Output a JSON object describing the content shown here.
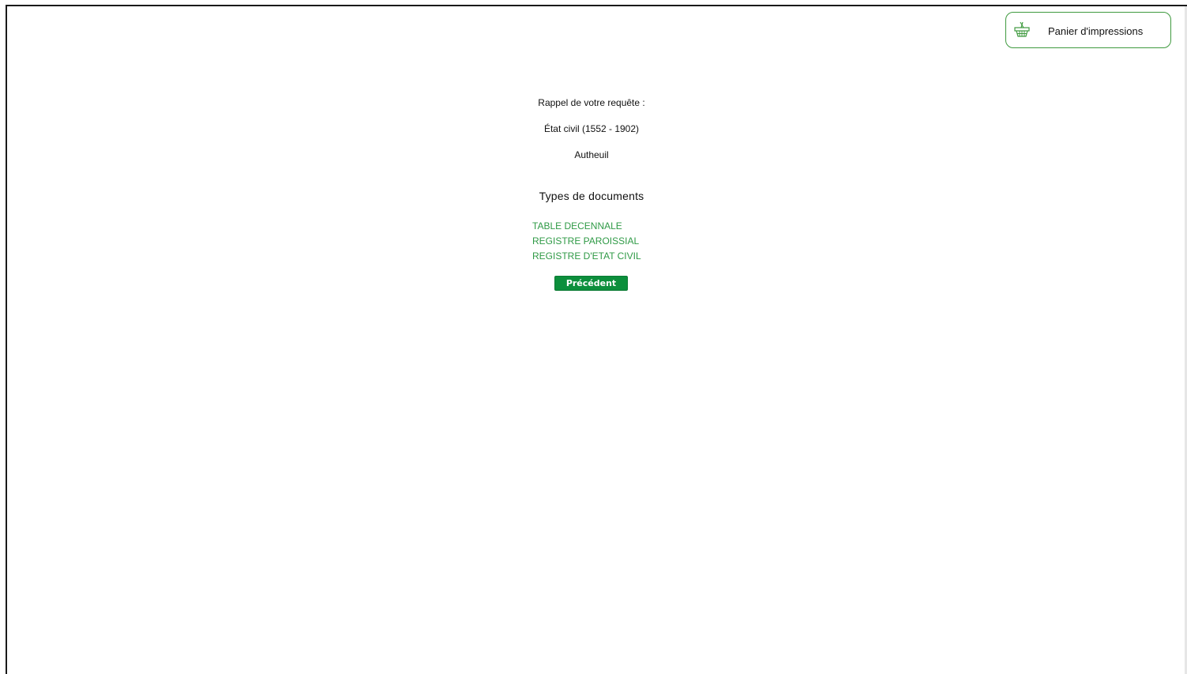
{
  "header": {
    "cart_label": "Panier d'impressions",
    "cart_icon": "basket-icon"
  },
  "query": {
    "recall_label": "Rappel de votre requête :",
    "fonds": "État civil (1552 - 1902)",
    "place": "Autheuil"
  },
  "documents": {
    "heading": "Types de documents",
    "items": [
      {
        "label": "TABLE DECENNALE"
      },
      {
        "label": "REGISTRE PAROISSIAL"
      },
      {
        "label": "REGISTRE D'ETAT CIVIL"
      }
    ]
  },
  "navigation": {
    "previous_label": "Précédent"
  },
  "colors": {
    "accent": "#2f9a46",
    "button_green": "#0c8f3c",
    "border_green": "#3f9a3f"
  }
}
